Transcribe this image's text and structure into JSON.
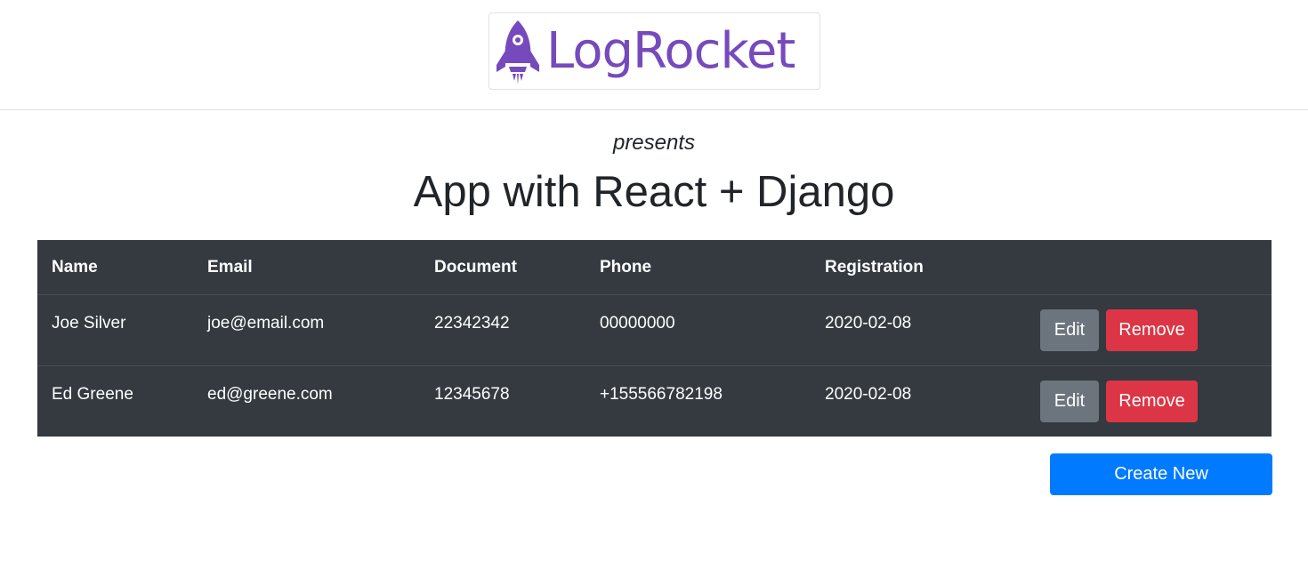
{
  "header": {
    "logo_text": "LogRocket"
  },
  "presents": "presents",
  "title": "App with React + Django",
  "table": {
    "columns": [
      "Name",
      "Email",
      "Document",
      "Phone",
      "Registration"
    ],
    "rows": [
      {
        "name": "Joe Silver",
        "email": "joe@email.com",
        "document": "22342342",
        "phone": "00000000",
        "registration": "2020-02-08",
        "edit_label": "Edit",
        "remove_label": "Remove"
      },
      {
        "name": "Ed Greene",
        "email": "ed@greene.com",
        "document": "12345678",
        "phone": "+155566782198",
        "registration": "2020-02-08",
        "edit_label": "Edit",
        "remove_label": "Remove"
      }
    ]
  },
  "create_label": "Create New",
  "colors": {
    "brand": "#764abc",
    "table_bg": "#343a40",
    "edit_button": "#6c757d",
    "remove_button": "#dc3545",
    "create_button": "#007bff"
  }
}
